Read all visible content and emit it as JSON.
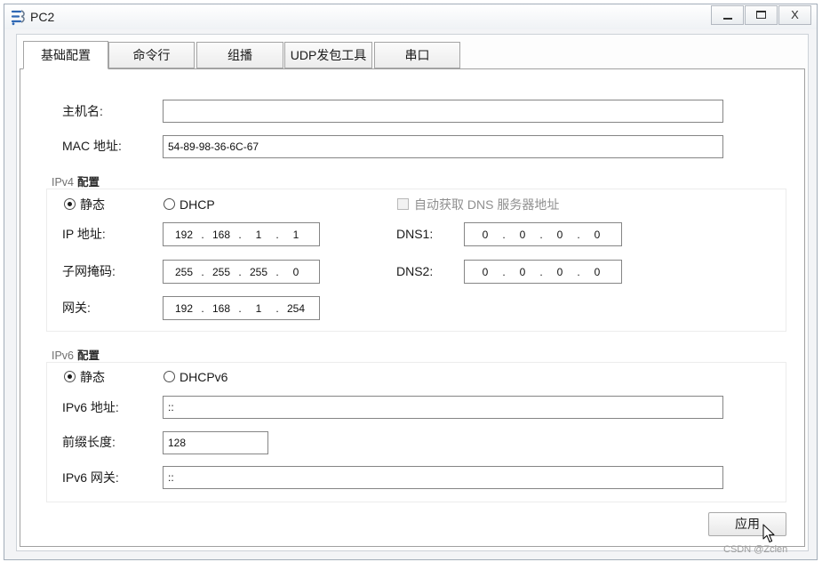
{
  "window": {
    "title": "PC2",
    "close_glyph": "X"
  },
  "tabs": [
    {
      "label": "基础配置",
      "active": true
    },
    {
      "label": "命令行",
      "active": false
    },
    {
      "label": "组播",
      "active": false
    },
    {
      "label": "UDP发包工具",
      "active": false
    },
    {
      "label": "串口",
      "active": false
    }
  ],
  "basic": {
    "hostname": {
      "label": "主机名:",
      "value": ""
    },
    "mac": {
      "label": "MAC 地址:",
      "value": "54-89-98-36-6C-67"
    }
  },
  "ip_separator": ".",
  "ipv4": {
    "title": "IPv4",
    "title_suffix": "配置",
    "modes": [
      {
        "label": "静态",
        "selected": true
      },
      {
        "label": "DHCP",
        "selected": false
      }
    ],
    "auto_dns": {
      "label": "自动获取 DNS 服务器地址",
      "checked": false,
      "enabled": false
    },
    "ip_address": {
      "label": "IP 地址:",
      "octets": [
        "192",
        "168",
        "1",
        "1"
      ]
    },
    "subnet_mask": {
      "label": "子网掩码:",
      "octets": [
        "255",
        "255",
        "255",
        "0"
      ]
    },
    "gateway": {
      "label": "网关:",
      "octets": [
        "192",
        "168",
        "1",
        "254"
      ]
    },
    "dns1": {
      "label": "DNS1:",
      "octets": [
        "0",
        "0",
        "0",
        "0"
      ]
    },
    "dns2": {
      "label": "DNS2:",
      "octets": [
        "0",
        "0",
        "0",
        "0"
      ]
    }
  },
  "ipv6": {
    "title": "IPv6",
    "title_suffix": "配置",
    "modes": [
      {
        "label": "静态",
        "selected": true
      },
      {
        "label": "DHCPv6",
        "selected": false
      }
    ],
    "address": {
      "label": "IPv6 地址:",
      "value": "::"
    },
    "prefix_length": {
      "label": "前缀长度:",
      "value": "128"
    },
    "gateway": {
      "label": "IPv6 网关:",
      "value": "::"
    }
  },
  "apply_button": {
    "label": "应用"
  },
  "watermark": "CSDN @Zcien",
  "icons": {
    "app": "network-pc-icon",
    "minimize": "minimize-icon",
    "maximize": "maximize-icon",
    "close": "close-icon",
    "cursor": "mouse-cursor-icon"
  },
  "colors": {
    "panel_background": "#ffffff",
    "input_border": "#858585",
    "disabled_text": "#8f8f8f",
    "app_icon_blue": "#2f68b4"
  }
}
